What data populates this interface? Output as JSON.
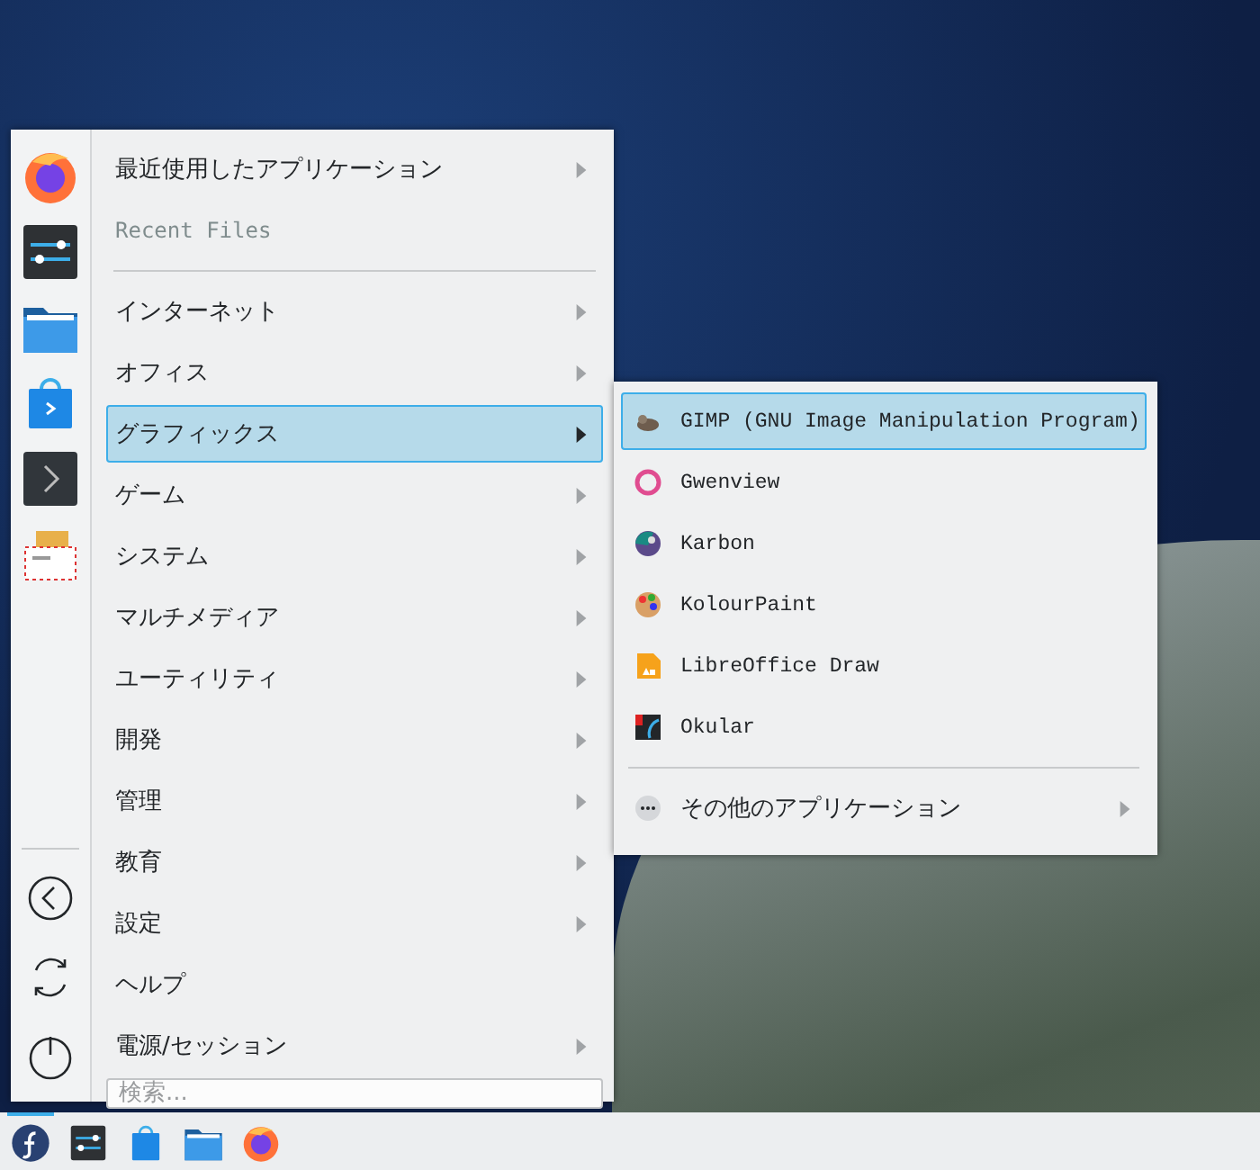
{
  "sidebar": {
    "favorites": [
      {
        "kind": "firefox"
      },
      {
        "kind": "settings"
      },
      {
        "kind": "folder"
      },
      {
        "kind": "store"
      },
      {
        "kind": "terminal"
      },
      {
        "kind": "mail"
      }
    ],
    "actions": [
      {
        "kind": "back"
      },
      {
        "kind": "refresh"
      },
      {
        "kind": "power"
      }
    ]
  },
  "menu": {
    "items": [
      {
        "label": "最近使用したアプリケーション",
        "has_submenu": true,
        "disabled": false,
        "selected": false
      },
      {
        "label": "Recent Files",
        "has_submenu": false,
        "disabled": true,
        "selected": false,
        "separator_after": true
      },
      {
        "label": "インターネット",
        "has_submenu": true,
        "disabled": false,
        "selected": false
      },
      {
        "label": "オフィス",
        "has_submenu": true,
        "disabled": false,
        "selected": false
      },
      {
        "label": "グラフィックス",
        "has_submenu": true,
        "disabled": false,
        "selected": true
      },
      {
        "label": "ゲーム",
        "has_submenu": true,
        "disabled": false,
        "selected": false
      },
      {
        "label": "システム",
        "has_submenu": true,
        "disabled": false,
        "selected": false
      },
      {
        "label": "マルチメディア",
        "has_submenu": true,
        "disabled": false,
        "selected": false
      },
      {
        "label": "ユーティリティ",
        "has_submenu": true,
        "disabled": false,
        "selected": false
      },
      {
        "label": "開発",
        "has_submenu": true,
        "disabled": false,
        "selected": false
      },
      {
        "label": "管理",
        "has_submenu": true,
        "disabled": false,
        "selected": false
      },
      {
        "label": "教育",
        "has_submenu": true,
        "disabled": false,
        "selected": false
      },
      {
        "label": "設定",
        "has_submenu": true,
        "disabled": false,
        "selected": false
      },
      {
        "label": "ヘルプ",
        "has_submenu": false,
        "disabled": false,
        "selected": false
      },
      {
        "label": "電源/セッション",
        "has_submenu": true,
        "disabled": false,
        "selected": false
      }
    ],
    "search": {
      "placeholder": "検索..."
    }
  },
  "submenu": {
    "items": [
      {
        "label": "GIMP (GNU Image Manipulation Program)",
        "kind": "gimp",
        "selected": true,
        "has_submenu": false
      },
      {
        "label": "Gwenview",
        "kind": "gwenview",
        "selected": false,
        "has_submenu": false
      },
      {
        "label": "Karbon",
        "kind": "karbon",
        "selected": false,
        "has_submenu": false
      },
      {
        "label": "KolourPaint",
        "kind": "kolourpaint",
        "selected": false,
        "has_submenu": false
      },
      {
        "label": "LibreOffice Draw",
        "kind": "draw",
        "selected": false,
        "has_submenu": false
      },
      {
        "label": "Okular",
        "kind": "okular",
        "selected": false,
        "has_submenu": false,
        "separator_after": true
      },
      {
        "label": "その他のアプリケーション",
        "kind": "more",
        "selected": false,
        "has_submenu": true
      }
    ]
  },
  "taskbar": {
    "items": [
      {
        "kind": "fedora",
        "active": true
      },
      {
        "kind": "settings",
        "active": false
      },
      {
        "kind": "store",
        "active": false
      },
      {
        "kind": "folder",
        "active": false
      },
      {
        "kind": "firefox",
        "active": false
      }
    ]
  }
}
